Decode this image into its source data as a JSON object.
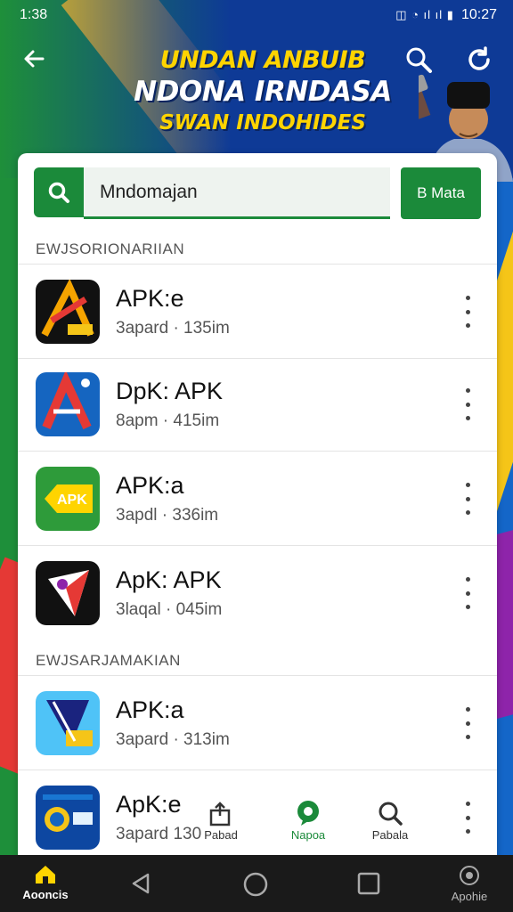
{
  "status_bar": {
    "time_left": "1:38",
    "time_right": "10:27",
    "signal_text": "◫ ◔ ıl ıl ▮"
  },
  "header": {
    "banner_line1": "UNDAN ANBUIB",
    "banner_line2": "NDONA IRNDASA",
    "banner_line3": "SWAN INDOHIDES"
  },
  "search": {
    "value": "Mndomajan",
    "button_label": "B Mata"
  },
  "sections": [
    {
      "label": "EWJSORIONARIIAN",
      "items": [
        {
          "title": "APK:e",
          "subtitle": "3apard · 135im",
          "icon": "apk-red-a-icon"
        },
        {
          "title": "DpK: APK",
          "subtitle": "8apm · 415im",
          "icon": "apk-blue-a-icon"
        },
        {
          "title": "APK:a",
          "subtitle": "3apdl · 336im",
          "icon": "apk-green-icon"
        },
        {
          "title": "ApK: APK",
          "subtitle": "3laqal · 045im",
          "icon": "apk-black-icon"
        }
      ]
    },
    {
      "label": "EWJSARJAMAKIAN",
      "items": [
        {
          "title": "APK:a",
          "subtitle": "3apard · 313im",
          "icon": "apk-poster-icon"
        },
        {
          "title": "ApK:e",
          "subtitle": "3apard 130",
          "icon": "apk-seal-icon"
        }
      ]
    }
  ],
  "floating_tabs": [
    {
      "label": "Pabad",
      "icon": "share-icon"
    },
    {
      "label": "Napoa",
      "icon": "chat-icon"
    },
    {
      "label": "Pabala",
      "icon": "search-icon"
    }
  ],
  "navbar": {
    "home_label": "Aooncis",
    "extra_label": "Apohie"
  },
  "colors": {
    "primary_green": "#1b8a3a",
    "accent_yellow": "#ffd400",
    "brand_blue": "#0e3a96"
  }
}
